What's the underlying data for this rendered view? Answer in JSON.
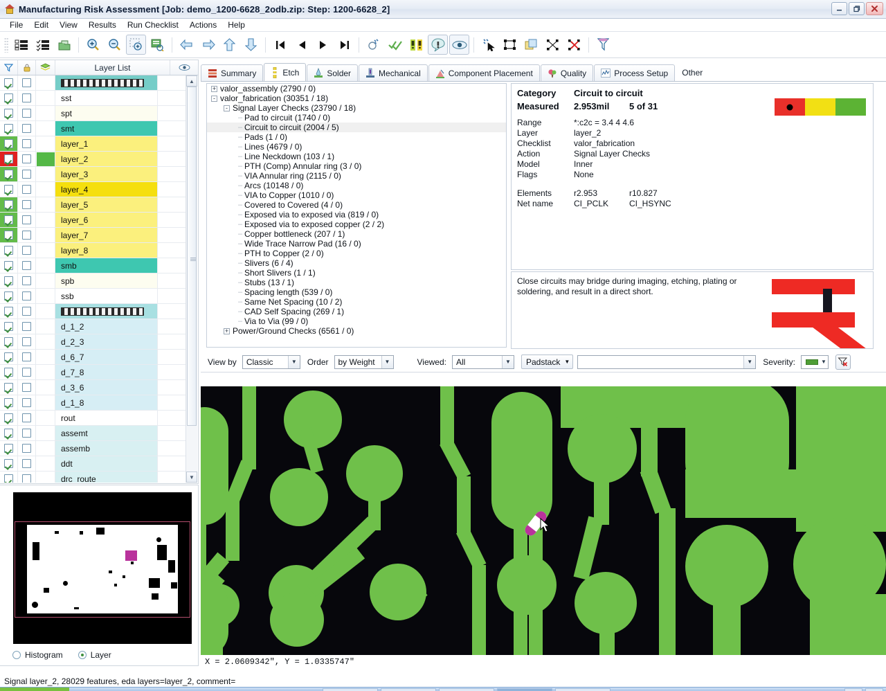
{
  "window": {
    "title": "Manufacturing Risk Assessment [Job: demo_1200-6628_2odb.zip: Step: 1200-6628_2]",
    "icon": "factory-icon",
    "buttons": {
      "minimize": "_",
      "maximize": "❐",
      "close": "✕"
    }
  },
  "menubar": {
    "items": [
      {
        "label": "File"
      },
      {
        "label": "Edit"
      },
      {
        "label": "View"
      },
      {
        "label": "Results"
      },
      {
        "label": "Run Checklist"
      },
      {
        "label": "Actions"
      },
      {
        "label": "Help"
      }
    ]
  },
  "toolbar": {
    "groups": [
      {
        "buttons": [
          {
            "name": "list-view-icon",
            "glyph": "▤"
          },
          {
            "name": "checklist-icon",
            "glyph": "☰"
          },
          {
            "name": "open-package-icon",
            "glyph": "⬛"
          }
        ]
      },
      {
        "buttons": [
          {
            "name": "zoom-in-icon",
            "glyph": "⊕"
          },
          {
            "name": "zoom-out-icon",
            "glyph": "⊖"
          },
          {
            "name": "zoom-window-icon",
            "glyph": "⬚",
            "pressed": true
          },
          {
            "name": "zoom-report-icon",
            "glyph": "▥"
          }
        ]
      },
      {
        "buttons": [
          {
            "name": "undo-arrow-icon",
            "glyph": "↶"
          },
          {
            "name": "redo-arrow-icon",
            "glyph": "↷"
          },
          {
            "name": "up-arrow-icon",
            "glyph": "⇧"
          },
          {
            "name": "down-arrow-icon",
            "glyph": "⇩"
          }
        ]
      },
      {
        "buttons": [
          {
            "name": "first-item-icon",
            "glyph": "⏮"
          },
          {
            "name": "previous-item-icon",
            "glyph": "◀"
          },
          {
            "name": "next-item-icon",
            "glyph": "▶"
          },
          {
            "name": "last-item-icon",
            "glyph": "⏭"
          }
        ]
      },
      {
        "buttons": [
          {
            "name": "measure-icon",
            "glyph": "⌖"
          },
          {
            "name": "approve-all-icon",
            "glyph": "✔"
          },
          {
            "name": "severity-flags-icon",
            "glyph": "❙"
          },
          {
            "name": "highlight-defect-icon",
            "glyph": "⌘",
            "pressed": true
          },
          {
            "name": "eye-preview-icon",
            "glyph": "◉",
            "pressed": true
          }
        ]
      },
      {
        "buttons": [
          {
            "name": "select-features-icon",
            "glyph": "✧"
          },
          {
            "name": "select-box-icon",
            "glyph": "▭"
          },
          {
            "name": "copy-layer-icon",
            "glyph": "❐"
          },
          {
            "name": "transform-icon",
            "glyph": "⯃"
          },
          {
            "name": "clear-selection-icon",
            "glyph": "⯄"
          }
        ]
      },
      {
        "buttons": [
          {
            "name": "filter-icon",
            "glyph": "⚗"
          }
        ]
      }
    ]
  },
  "layer_panel": {
    "headers": {
      "filter_icon": "filter-icon",
      "lock_icon": "lock-icon",
      "layers_icon": "layers-icon",
      "title": "Layer List",
      "eye_icon": "eye-icon"
    },
    "rows": [
      {
        "name": "▓▓▓▓▓▓",
        "display": "drill-top-pattern",
        "bg": "#76cdc8",
        "checked": true,
        "selected": false,
        "swatch": null,
        "pattern": true
      },
      {
        "name": "sst",
        "bg": "#ffffff",
        "checked": true,
        "selected": false,
        "swatch": null
      },
      {
        "name": "spt",
        "bg": "#fdfdf0",
        "checked": true,
        "selected": false,
        "swatch": null
      },
      {
        "name": "smt",
        "bg": "#3ec7b0",
        "checked": true,
        "selected": false,
        "swatch": null
      },
      {
        "name": "layer_1",
        "bg": "#fbf07d",
        "checked": true,
        "selected": false,
        "swatch": null,
        "chkbg": "#63bb4a"
      },
      {
        "name": "layer_2",
        "bg": "#fbf07d",
        "checked": true,
        "selected": true,
        "swatch": "#54b847",
        "chkbg": "#e02020"
      },
      {
        "name": "layer_3",
        "bg": "#fbf07d",
        "checked": true,
        "selected": false,
        "swatch": null,
        "chkbg": "#63bb4a"
      },
      {
        "name": "layer_4",
        "bg": "#f5df0e",
        "checked": true,
        "selected": false,
        "swatch": null
      },
      {
        "name": "layer_5",
        "bg": "#fbf07d",
        "checked": true,
        "selected": false,
        "swatch": null,
        "chkbg": "#63bb4a"
      },
      {
        "name": "layer_6",
        "bg": "#fbf07d",
        "checked": true,
        "selected": false,
        "swatch": null,
        "chkbg": "#63bb4a"
      },
      {
        "name": "layer_7",
        "bg": "#fbf07d",
        "checked": true,
        "selected": false,
        "swatch": null,
        "chkbg": "#63bb4a"
      },
      {
        "name": "layer_8",
        "bg": "#fbf07d",
        "checked": true,
        "selected": false,
        "swatch": null
      },
      {
        "name": "smb",
        "bg": "#3ec7b0",
        "checked": true,
        "selected": false,
        "swatch": null
      },
      {
        "name": "spb",
        "bg": "#fdfdf0",
        "checked": true,
        "selected": false,
        "swatch": null
      },
      {
        "name": "ssb",
        "bg": "#ffffff",
        "checked": true,
        "selected": false,
        "swatch": null
      },
      {
        "name": "▓▓▓▓▓▓",
        "display": "drill-bottom-pattern",
        "bg": "#a8e0e2",
        "checked": true,
        "selected": false,
        "swatch": null,
        "pattern": true
      },
      {
        "name": "d_1_2",
        "bg": "#d6eef5",
        "checked": true,
        "selected": false,
        "swatch": null
      },
      {
        "name": "d_2_3",
        "bg": "#d6eef5",
        "checked": true,
        "selected": false,
        "swatch": null
      },
      {
        "name": "d_6_7",
        "bg": "#d6eef5",
        "checked": true,
        "selected": false,
        "swatch": null
      },
      {
        "name": "d_7_8",
        "bg": "#d6eef5",
        "checked": true,
        "selected": false,
        "swatch": null
      },
      {
        "name": "d_3_6",
        "bg": "#d6eef5",
        "checked": true,
        "selected": false,
        "swatch": null
      },
      {
        "name": "d_1_8",
        "bg": "#d6eef5",
        "checked": true,
        "selected": false,
        "swatch": null
      },
      {
        "name": "rout",
        "bg": "#ffffff",
        "checked": true,
        "selected": false,
        "swatch": null
      },
      {
        "name": "assemt",
        "bg": "#d8f0f2",
        "checked": true,
        "selected": false,
        "swatch": null
      },
      {
        "name": "assemb",
        "bg": "#d8f0f2",
        "checked": true,
        "selected": false,
        "swatch": null
      },
      {
        "name": "ddt",
        "bg": "#d8f0f2",
        "checked": true,
        "selected": false,
        "swatch": null
      },
      {
        "name": "drc_route",
        "bg": "#d8f0f2",
        "checked": true,
        "selected": false,
        "swatch": null
      }
    ]
  },
  "preview": {
    "histogram_label": "Histogram",
    "layer_label": "Layer",
    "selected": "Layer"
  },
  "tabs": [
    {
      "label": "Summary",
      "icon": "summary-icon",
      "active": false
    },
    {
      "label": "Etch",
      "icon": "etch-icon",
      "active": true
    },
    {
      "label": "Solder",
      "icon": "solder-icon",
      "active": false
    },
    {
      "label": "Mechanical",
      "icon": "mechanical-icon",
      "active": false
    },
    {
      "label": "Component Placement",
      "icon": "component-placement-icon",
      "active": false
    },
    {
      "label": "Quality",
      "icon": "quality-icon",
      "active": false
    },
    {
      "label": "Process Setup",
      "icon": "process-setup-icon",
      "active": false
    },
    {
      "label": "Other",
      "icon": "other-icon",
      "active": false
    }
  ],
  "tree": [
    {
      "label": "valor_assembly (2790 / 0)",
      "indent": 0,
      "expander": "+",
      "selected": false
    },
    {
      "label": "valor_fabrication (30351 / 18)",
      "indent": 0,
      "expander": "-",
      "selected": false
    },
    {
      "label": "Signal Layer Checks (23790 / 18)",
      "indent": 1,
      "expander": "-",
      "selected": false
    },
    {
      "label": "Pad to circuit (1740 / 0)",
      "indent": 2,
      "expander": "",
      "selected": false
    },
    {
      "label": "Circuit to circuit (2004 / 5)",
      "indent": 2,
      "expander": "",
      "selected": true
    },
    {
      "label": "Pads (1 / 0)",
      "indent": 2,
      "expander": "",
      "selected": false
    },
    {
      "label": "Lines (4679 / 0)",
      "indent": 2,
      "expander": "",
      "selected": false
    },
    {
      "label": "Line Neckdown (103 / 1)",
      "indent": 2,
      "expander": "",
      "selected": false
    },
    {
      "label": "PTH (Comp) Annular ring (3 / 0)",
      "indent": 2,
      "expander": "",
      "selected": false
    },
    {
      "label": "VIA Annular ring (2115 / 0)",
      "indent": 2,
      "expander": "",
      "selected": false
    },
    {
      "label": "Arcs (10148 / 0)",
      "indent": 2,
      "expander": "",
      "selected": false
    },
    {
      "label": "VIA to Copper (1010 / 0)",
      "indent": 2,
      "expander": "",
      "selected": false
    },
    {
      "label": "Covered to Covered (4 / 0)",
      "indent": 2,
      "expander": "",
      "selected": false
    },
    {
      "label": "Exposed via to exposed via (819 / 0)",
      "indent": 2,
      "expander": "",
      "selected": false
    },
    {
      "label": "Exposed via to exposed copper (2 / 2)",
      "indent": 2,
      "expander": "",
      "selected": false
    },
    {
      "label": "Copper bottleneck (207 / 1)",
      "indent": 2,
      "expander": "",
      "selected": false
    },
    {
      "label": "Wide Trace Narrow Pad (16 / 0)",
      "indent": 2,
      "expander": "",
      "selected": false
    },
    {
      "label": "PTH to Copper (2 / 0)",
      "indent": 2,
      "expander": "",
      "selected": false
    },
    {
      "label": "Slivers (6 / 4)",
      "indent": 2,
      "expander": "",
      "selected": false
    },
    {
      "label": "Short Slivers (1 / 1)",
      "indent": 2,
      "expander": "",
      "selected": false
    },
    {
      "label": "Stubs (13 / 1)",
      "indent": 2,
      "expander": "",
      "selected": false
    },
    {
      "label": "Spacing length (539 / 0)",
      "indent": 2,
      "expander": "",
      "selected": false
    },
    {
      "label": "Same Net Spacing (10 / 2)",
      "indent": 2,
      "expander": "",
      "selected": false
    },
    {
      "label": "CAD Self Spacing (269 / 1)",
      "indent": 2,
      "expander": "",
      "selected": false
    },
    {
      "label": "Via to Via (99 / 0)",
      "indent": 2,
      "expander": "",
      "selected": false
    },
    {
      "label": "Power/Ground Checks (6561 / 0)",
      "indent": 1,
      "expander": "+",
      "selected": false
    }
  ],
  "details": {
    "category_label": "Category",
    "category_value": "Circuit to circuit",
    "measured_label": "Measured",
    "measured_value": "2.953mil",
    "measured_index": "5 of 31",
    "fields": [
      {
        "label": "Range",
        "value": "*:c2c   = 3.4 4 4.6"
      },
      {
        "label": "Layer",
        "value": "layer_2"
      },
      {
        "label": "Checklist",
        "value": "valor_fabrication"
      },
      {
        "label": "Action",
        "value": "Signal Layer Checks"
      },
      {
        "label": "Model",
        "value": "Inner"
      },
      {
        "label": "Flags",
        "value": "None"
      }
    ],
    "elements_label": "Elements",
    "elements_value_1": "r2.953",
    "elements_value_2": "r10.827",
    "netname_label": "Net name",
    "netname_value_1": "CI_PCLK",
    "netname_value_2": "CI_HSYNC",
    "severity_colors": {
      "high": "#e8302a",
      "medium": "#f2e014",
      "low": "#5cb334"
    },
    "severity_active": "high"
  },
  "description": {
    "text": "Close circuits may bridge during imaging, etching, plating or soldering, and result in a direct short.",
    "figure": "short-circuit-diagram"
  },
  "controls": {
    "viewby_label": "View by",
    "viewby_value": "Classic",
    "order_label": "Order",
    "order_value": "by Weight",
    "viewed_label": "Viewed:",
    "viewed_value": "All",
    "padstack_label": "Padstack",
    "filter_value": "",
    "filter_placeholder": "",
    "severity_label": "Severity:",
    "severity_swatch": "#4f9e36",
    "clear_button_icon": "clear-filter-icon"
  },
  "canvas": {
    "background": "#07070c",
    "copper_color": "#6fc04a",
    "defect_marker": "defect-marker",
    "coordinates": "X = 2.0609342\", Y = 1.0335747\""
  },
  "statusbar": {
    "text": "Signal layer_2, 28029 features, eda layers=layer_2, comment="
  }
}
